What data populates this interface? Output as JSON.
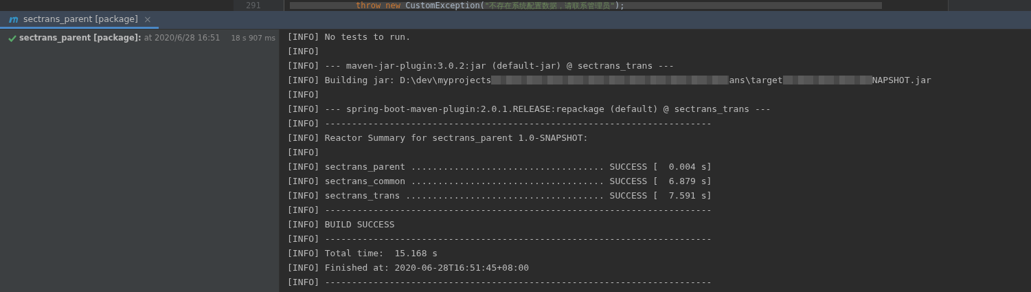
{
  "editor": {
    "line_number": "291",
    "code": [
      {
        "kind": "keyword",
        "text": "throw new "
      },
      {
        "kind": "plain",
        "text": "CustomException("
      },
      {
        "kind": "string",
        "text": "\"不存在系统配置数据，请联系管理员\""
      },
      {
        "kind": "plain",
        "text": ");"
      }
    ]
  },
  "tab": {
    "title": "sectrans_parent [package]",
    "selected": true,
    "close": "×"
  },
  "run_tree": [
    {
      "name": "sectrans_parent [package]:",
      "time": "at 2020/6/28 16:51",
      "duration": "18 s 907 ms",
      "passed": true
    }
  ],
  "console": [
    {
      "segments": [
        {
          "kind": "text",
          "text": "[INFO] No tests to run."
        }
      ]
    },
    {
      "segments": [
        {
          "kind": "text",
          "text": "[INFO]"
        }
      ]
    },
    {
      "segments": [
        {
          "kind": "text",
          "text": "[INFO] --- maven-jar-plugin:3.0.2:jar (default-jar) @ sectrans_trans ---"
        }
      ]
    },
    {
      "segments": [
        {
          "kind": "text",
          "text": "[INFO] Building jar: D:\\dev\\myprojects"
        },
        {
          "kind": "redacted"
        },
        {
          "kind": "text",
          "text": "ans\\target"
        },
        {
          "kind": "redacted"
        },
        {
          "kind": "text",
          "text": "NAPSHOT.jar"
        }
      ]
    },
    {
      "segments": [
        {
          "kind": "text",
          "text": "[INFO]"
        }
      ]
    },
    {
      "segments": [
        {
          "kind": "text",
          "text": "[INFO] --- spring-boot-maven-plugin:2.0.1.RELEASE:repackage (default) @ sectrans_trans ---"
        }
      ]
    },
    {
      "segments": [
        {
          "kind": "text",
          "text": "[INFO] ------------------------------------------------------------------------"
        }
      ]
    },
    {
      "segments": [
        {
          "kind": "text",
          "text": "[INFO] Reactor Summary for sectrans_parent 1.0-SNAPSHOT:"
        }
      ]
    },
    {
      "segments": [
        {
          "kind": "text",
          "text": "[INFO]"
        }
      ]
    },
    {
      "segments": [
        {
          "kind": "text",
          "text": "[INFO] sectrans_parent .................................... SUCCESS [  0.004 s]"
        }
      ]
    },
    {
      "segments": [
        {
          "kind": "text",
          "text": "[INFO] sectrans_common .................................... SUCCESS [  6.879 s]"
        }
      ]
    },
    {
      "segments": [
        {
          "kind": "text",
          "text": "[INFO] sectrans_trans ..................................... SUCCESS [  7.591 s]"
        }
      ]
    },
    {
      "segments": [
        {
          "kind": "text",
          "text": "[INFO] ------------------------------------------------------------------------"
        }
      ]
    },
    {
      "segments": [
        {
          "kind": "text",
          "text": "[INFO] BUILD SUCCESS"
        }
      ]
    },
    {
      "segments": [
        {
          "kind": "text",
          "text": "[INFO] ------------------------------------------------------------------------"
        }
      ]
    },
    {
      "segments": [
        {
          "kind": "text",
          "text": "[INFO] Total time:  15.168 s"
        }
      ]
    },
    {
      "segments": [
        {
          "kind": "text",
          "text": "[INFO] Finished at: 2020-06-28T16:51:45+08:00"
        }
      ]
    },
    {
      "segments": [
        {
          "kind": "text",
          "text": "[INFO] ------------------------------------------------------------------------"
        }
      ]
    }
  ]
}
